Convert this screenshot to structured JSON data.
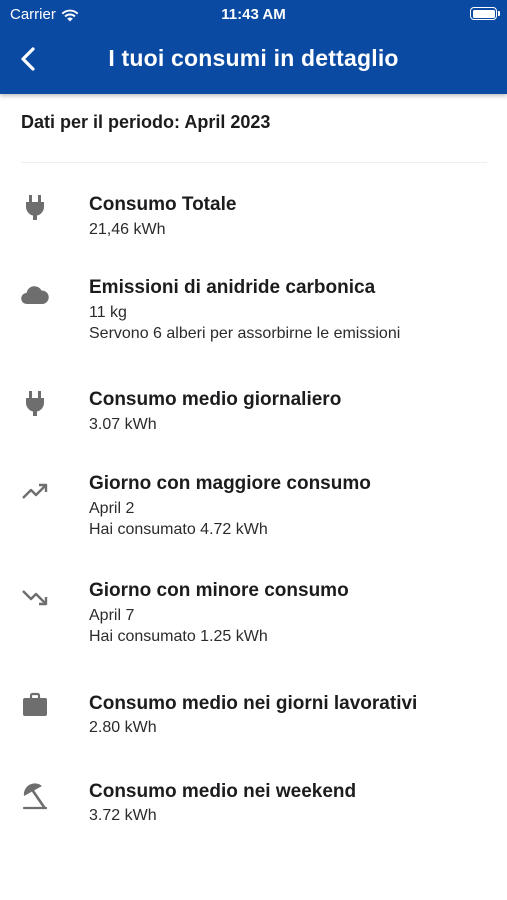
{
  "status_bar": {
    "carrier": "Carrier",
    "time": "11:43 AM"
  },
  "nav": {
    "title": "I tuoi consumi in dettaglio"
  },
  "period_label": "Dati per il periodo: April 2023",
  "items": [
    {
      "icon": "plug-icon",
      "title": "Consumo Totale",
      "lines": [
        "21,46 kWh"
      ]
    },
    {
      "icon": "cloud-icon",
      "title": "Emissioni di anidride carbonica",
      "lines": [
        "11 kg",
        "Servono 6 alberi per assorbirne le emissioni"
      ]
    },
    {
      "icon": "plug-icon",
      "title": "Consumo medio giornaliero",
      "lines": [
        "3.07 kWh"
      ]
    },
    {
      "icon": "trending-up-icon",
      "title": "Giorno con maggiore consumo",
      "lines": [
        "April 2",
        "Hai consumato 4.72 kWh"
      ]
    },
    {
      "icon": "trending-down-icon",
      "title": "Giorno con minore consumo",
      "lines": [
        "April 7",
        "Hai consumato 1.25 kWh"
      ]
    },
    {
      "icon": "briefcase-icon",
      "title": "Consumo medio nei giorni lavorativi",
      "lines": [
        "2.80 kWh"
      ]
    },
    {
      "icon": "beach-umbrella-icon",
      "title": "Consumo medio nei weekend",
      "lines": [
        "3.72 kWh"
      ]
    }
  ]
}
